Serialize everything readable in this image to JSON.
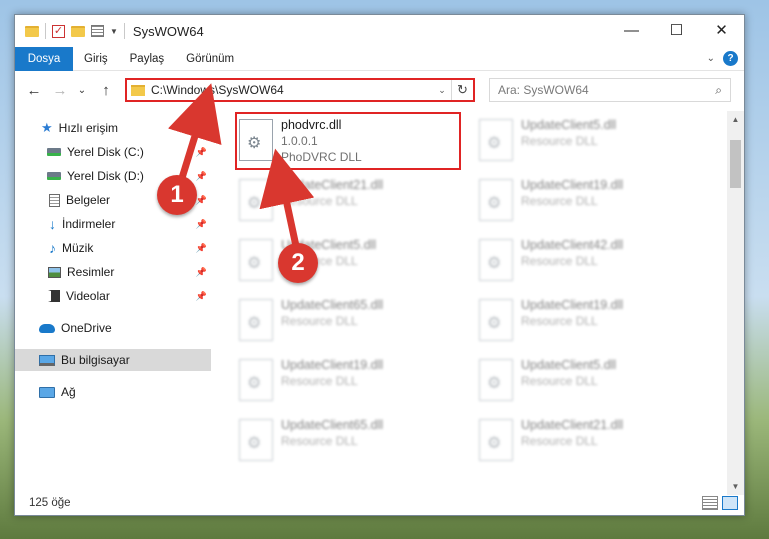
{
  "window": {
    "title": "SysWOW64",
    "minimize_icon": "—",
    "maximize_icon": "☐",
    "close_icon": "✕"
  },
  "ribbon": {
    "tabs": [
      "Dosya",
      "Giriş",
      "Paylaş",
      "Görünüm"
    ],
    "help_label": "?"
  },
  "nav": {
    "back": "←",
    "forward": "→",
    "recent": "⌄",
    "up": "↑"
  },
  "address": {
    "path": "C:\\Windows\\SysWOW64",
    "refresh": "↻"
  },
  "search": {
    "placeholder": "Ara: SysWOW64"
  },
  "sidebar": {
    "items": [
      {
        "label": "Hızlı erişim",
        "icon": "quick-access-star-icon"
      },
      {
        "label": "Yerel Disk (C:)",
        "icon": "disk-icon"
      },
      {
        "label": "Yerel Disk (D:)",
        "icon": "disk-icon"
      },
      {
        "label": "Belgeler",
        "icon": "documents-icon"
      },
      {
        "label": "İndirmeler",
        "icon": "downloads-icon"
      },
      {
        "label": "Müzik",
        "icon": "music-icon"
      },
      {
        "label": "Resimler",
        "icon": "pictures-icon"
      },
      {
        "label": "Videolar",
        "icon": "videos-icon"
      },
      {
        "label": "OneDrive",
        "icon": "onedrive-icon"
      },
      {
        "label": "Bu bilgisayar",
        "icon": "this-pc-icon"
      },
      {
        "label": "Ağ",
        "icon": "network-icon"
      }
    ]
  },
  "files": [
    {
      "name": "phodvrc.dll",
      "version": "1.0.0.1",
      "desc": "PhoDVRC DLL"
    },
    {
      "name": "UpdateClient5.dll",
      "desc": "Resource DLL"
    },
    {
      "name": "UpdateClient21.dll",
      "desc": "Resource DLL"
    },
    {
      "name": "UpdateClient19.dll",
      "desc": "Resource DLL"
    },
    {
      "name": "UpdateClient5.dll",
      "desc": "Resource DLL"
    },
    {
      "name": "UpdateClient42.dll",
      "desc": "Resource DLL"
    },
    {
      "name": "UpdateClient65.dll",
      "desc": "Resource DLL"
    },
    {
      "name": "UpdateClient19.dll",
      "desc": "Resource DLL"
    },
    {
      "name": "UpdateClient19.dll",
      "desc": "Resource DLL"
    },
    {
      "name": "UpdateClient5.dll",
      "desc": "Resource DLL"
    },
    {
      "name": "UpdateClient65.dll",
      "desc": "Resource DLL"
    },
    {
      "name": "UpdateClient21.dll",
      "desc": "Resource DLL"
    }
  ],
  "status": {
    "item_count": "125 öğe"
  },
  "callouts": [
    "1",
    "2"
  ],
  "colors": {
    "accent": "#1979ca",
    "highlight": "#e02424",
    "callout": "#d9372f"
  }
}
